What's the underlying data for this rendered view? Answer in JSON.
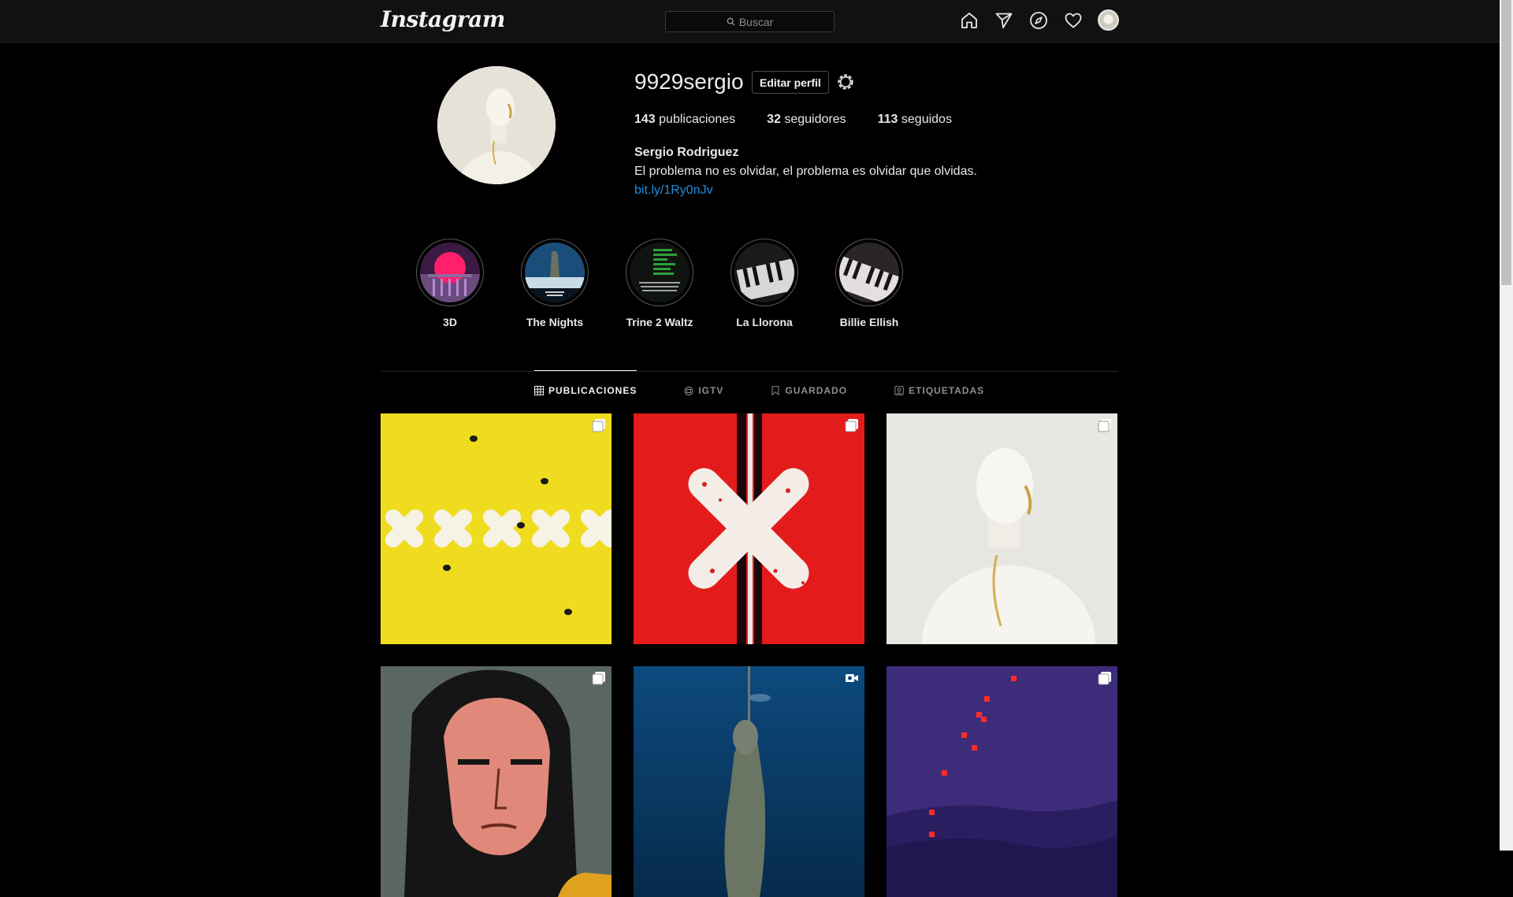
{
  "topbar": {
    "logo": "Instagram",
    "search_placeholder": "Buscar",
    "icons": [
      "home-icon",
      "direct-icon",
      "explore-icon",
      "activity-heart-icon",
      "profile-avatar"
    ]
  },
  "profile": {
    "username": "9929sergio",
    "edit_label": "Editar perfil",
    "stats": {
      "posts_count": "143",
      "posts_label": "publicaciones",
      "followers_count": "32",
      "followers_label": "seguidores",
      "following_count": "113",
      "following_label": "seguidos"
    },
    "full_name": "Sergio Rodriguez",
    "bio": "El problema no es olvidar, el problema es olvidar que olvidas.",
    "link": "bit.ly/1Ry0nJv"
  },
  "highlights": [
    {
      "label": "3D"
    },
    {
      "label": "The Nights"
    },
    {
      "label": "Trine 2 Waltz"
    },
    {
      "label": "La Llorona"
    },
    {
      "label": "Billie Ellish"
    }
  ],
  "tabs": [
    {
      "label": "PUBLICACIONES",
      "icon": "grid-icon",
      "active": true
    },
    {
      "label": "IGTV",
      "icon": "igtv-icon",
      "active": false
    },
    {
      "label": "GUARDADO",
      "icon": "bookmark-icon",
      "active": false
    },
    {
      "label": "ETIQUETADAS",
      "icon": "tagged-icon",
      "active": false
    }
  ],
  "posts": [
    {
      "badge": "carousel-icon"
    },
    {
      "badge": "carousel-icon"
    },
    {
      "badge": "carousel-icon"
    },
    {
      "badge": "carousel-icon"
    },
    {
      "badge": "video-icon"
    },
    {
      "badge": "carousel-icon"
    }
  ],
  "colors": {
    "background": "#000000",
    "topbar": "#111111",
    "link": "#1f8fe0",
    "post_yellow": "#f0dc1e",
    "post_red": "#e31b1b",
    "post_blue": "#0f3e6e",
    "post_purple": "#3d2c7a"
  }
}
